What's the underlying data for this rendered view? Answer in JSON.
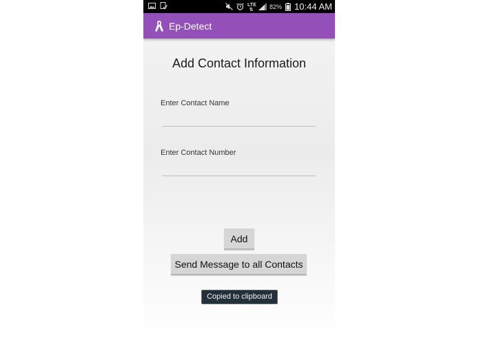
{
  "status_bar": {
    "battery_percent": "82%",
    "time": "10:44 AM",
    "network": "LTE",
    "icons": [
      "image-icon",
      "download-check-icon",
      "mute-icon",
      "alarm-icon",
      "lte-icon",
      "signal-icon",
      "battery-icon"
    ]
  },
  "app_bar": {
    "title": "Ep-Detect",
    "icon": "ribbon-icon",
    "color": "#9350b8"
  },
  "form": {
    "heading": "Add Contact Information",
    "name_label": "Enter Contact Name",
    "name_value": "",
    "number_label": "Enter Contact Number",
    "number_value": ""
  },
  "buttons": {
    "add": "Add",
    "send_all": "Send Message to all Contacts"
  },
  "toast": {
    "text": "Copied to clipboard"
  }
}
